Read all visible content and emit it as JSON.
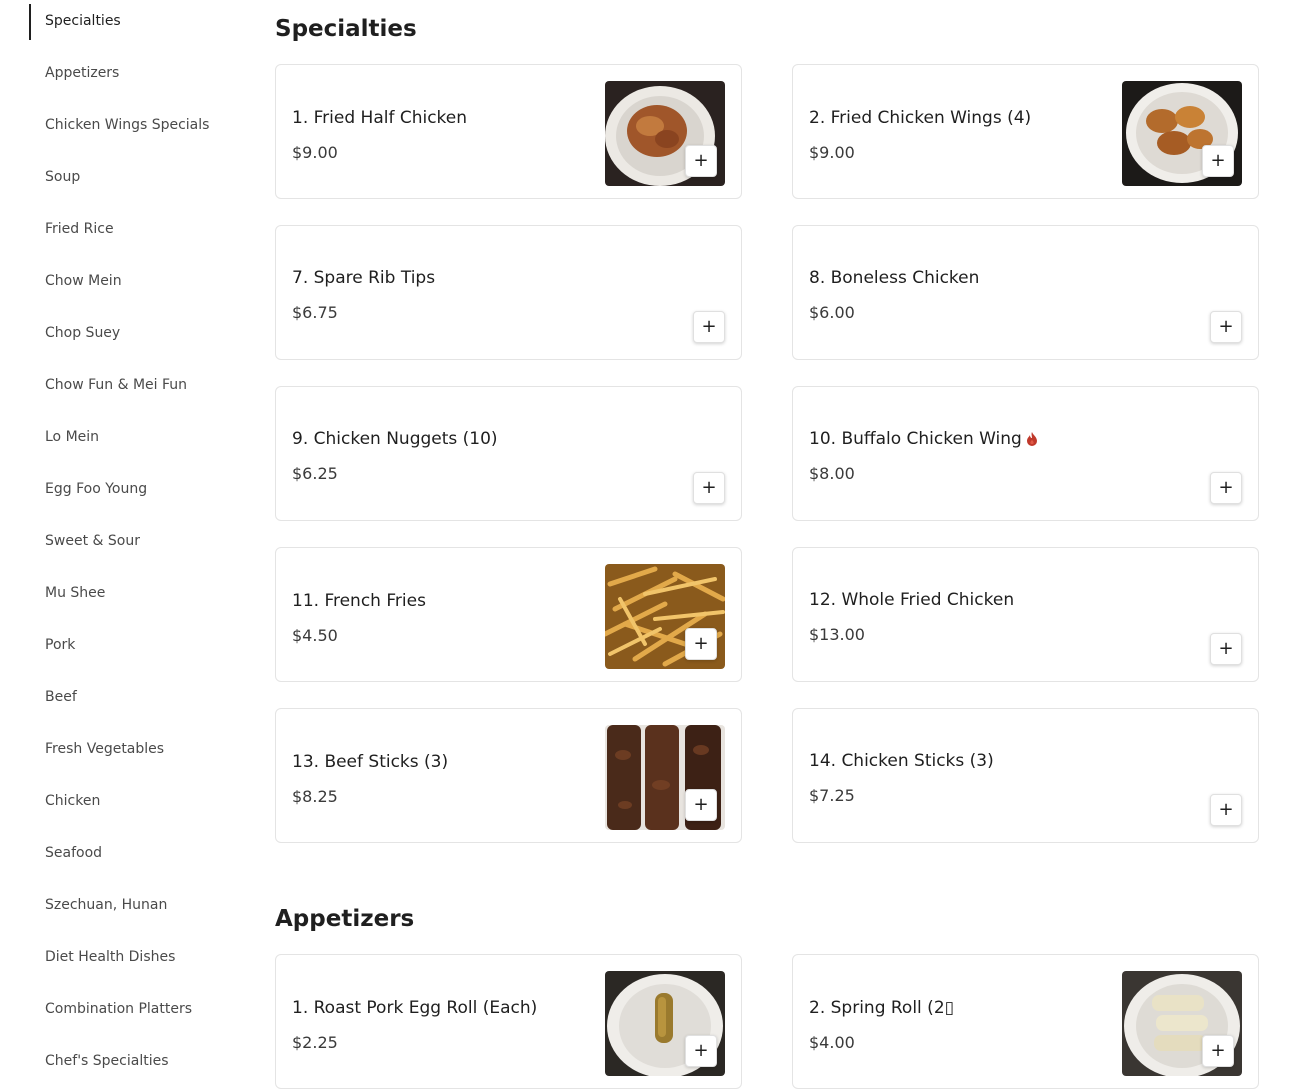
{
  "sidebar": {
    "items": [
      {
        "label": "Specialties"
      },
      {
        "label": "Appetizers"
      },
      {
        "label": "Chicken Wings Specials"
      },
      {
        "label": "Soup"
      },
      {
        "label": "Fried Rice"
      },
      {
        "label": "Chow Mein"
      },
      {
        "label": "Chop Suey"
      },
      {
        "label": "Chow Fun & Mei Fun"
      },
      {
        "label": "Lo Mein"
      },
      {
        "label": "Egg Foo Young"
      },
      {
        "label": "Sweet & Sour"
      },
      {
        "label": "Mu Shee"
      },
      {
        "label": "Pork"
      },
      {
        "label": "Beef"
      },
      {
        "label": "Fresh Vegetables"
      },
      {
        "label": "Chicken"
      },
      {
        "label": "Seafood"
      },
      {
        "label": "Szechuan, Hunan"
      },
      {
        "label": "Diet Health Dishes"
      },
      {
        "label": "Combination Platters"
      },
      {
        "label": "Chef's Specialties"
      }
    ]
  },
  "sections": [
    {
      "title": "Specialties",
      "items": [
        {
          "name": "1. Fried Half Chicken",
          "price": "$9.00",
          "image": "fried-chicken-photo"
        },
        {
          "name": "2. Fried Chicken Wings (4)",
          "price": "$9.00",
          "image": "chicken-wings-photo"
        },
        {
          "name": "7. Spare Rib Tips",
          "price": "$6.75"
        },
        {
          "name": "8. Boneless Chicken",
          "price": "$6.00"
        },
        {
          "name": "9. Chicken Nuggets (10)",
          "price": "$6.25"
        },
        {
          "name": "10. Buffalo Chicken Wing",
          "price": "$8.00",
          "icon": "spicy-icon"
        },
        {
          "name": "11. French Fries",
          "price": "$4.50",
          "image": "french-fries-photo"
        },
        {
          "name": "12. Whole Fried Chicken",
          "price": "$13.00"
        },
        {
          "name": "13. Beef Sticks (3)",
          "price": "$8.25",
          "image": "beef-sticks-photo"
        },
        {
          "name": "14. Chicken Sticks (3)",
          "price": "$7.25"
        }
      ]
    },
    {
      "title": "Appetizers",
      "items": [
        {
          "name": "1. Roast Pork Egg Roll (Each)",
          "price": "$2.25",
          "image": "egg-roll-photo"
        },
        {
          "name": "2. Spring Roll (2▯",
          "price": "$4.00",
          "image": "spring-roll-photo"
        }
      ]
    }
  ],
  "add_label": "+",
  "colors": {
    "text": "#1f1f1f",
    "border": "#e4e4e4",
    "spicy": "#c0392b"
  }
}
